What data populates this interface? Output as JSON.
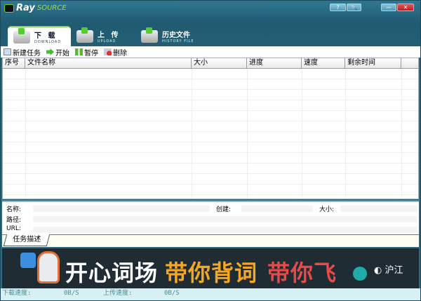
{
  "app": {
    "logo_text": "Ray",
    "logo_sub": "SOURCE"
  },
  "window_buttons": {
    "help": "?",
    "search": "🔍",
    "minimize": "—",
    "close": "✕"
  },
  "tabs": [
    {
      "label": "下 载",
      "sub": "DOWNLOAD",
      "active": true
    },
    {
      "label": "上 传",
      "sub": "UPLOAD",
      "active": false
    },
    {
      "label": "历史文件",
      "sub": "HISTORY FILE",
      "active": false
    }
  ],
  "toolbar": [
    {
      "label": "新建任务",
      "icon": "new-task-icon"
    },
    {
      "label": "开始",
      "icon": "play-icon"
    },
    {
      "label": "暂停",
      "icon": "pause-icon"
    },
    {
      "label": "删除",
      "icon": "delete-icon"
    }
  ],
  "table": {
    "columns": [
      "序号",
      "文件名称",
      "大小",
      "进度",
      "速度",
      "剩余时间",
      ""
    ],
    "rows": []
  },
  "details": {
    "name_label": "名称:",
    "created_label": "创建:",
    "size_label": "大小:",
    "path_label": "路径:",
    "url_label": "URL:"
  },
  "detail_tab": "任务描述",
  "banner": {
    "text1": "开心词场",
    "text2": "带你背词",
    "text3": "带你飞",
    "brand": "沪江"
  },
  "status": {
    "down_label": "下载速度:",
    "down_value": "0B/S",
    "up_label": "上传速度:",
    "up_value": "0B/S"
  },
  "colors": {
    "header": "#245f75",
    "accent_green": "#8dd05a",
    "status_bg": "#d6f0f3",
    "close": "#c8282c"
  }
}
